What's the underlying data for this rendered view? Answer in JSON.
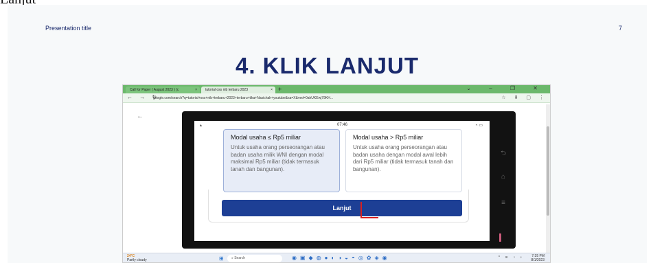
{
  "top_fragment": "Lanjut",
  "slide": {
    "presentation_title": "Presentation title",
    "page_number": "7",
    "heading": "4. KLIK LANJUT"
  },
  "browser": {
    "tabs": [
      {
        "label": "Call for Paper ( August 2023 ) (c"
      },
      {
        "label": "tutorial oss nib terbaru 2023"
      }
    ],
    "new_tab": "+",
    "url": "google.com/search?q=tutorial+oss+nib+terbaru+2023+terbaru+tika+Nasichah+youtube&sa=X&ved=0ahUKEwj79KH..."
  },
  "phone": {
    "status_time": "07:46",
    "cards": [
      {
        "title": "Modal usaha ≤ Rp5 miliar",
        "description": "Untuk usaha orang perseorangan atau badan usaha milik WNI dengan modal maksimal Rp5 miliar (tidak termasuk tanah dan bangunan)."
      },
      {
        "title": "Modal usaha > Rp5 miliar",
        "description": "Untuk usaha orang perseorangan atau badan usaha dengan modal awal lebih dari Rp5 miliar (tidak termasuk tanah dan bangunan)."
      }
    ],
    "next_button": "Lanjut"
  },
  "taskbar": {
    "weather_temp": "24°C",
    "weather_desc": "Partly cloudy",
    "search_placeholder": "Search",
    "clock_time": "7:35 PM",
    "clock_date": "8/1/2023"
  },
  "colors": {
    "heading": "#1a2a6c",
    "button": "#1d3f95",
    "tabbar": "#6bb86b",
    "annotation": "#d92020"
  }
}
